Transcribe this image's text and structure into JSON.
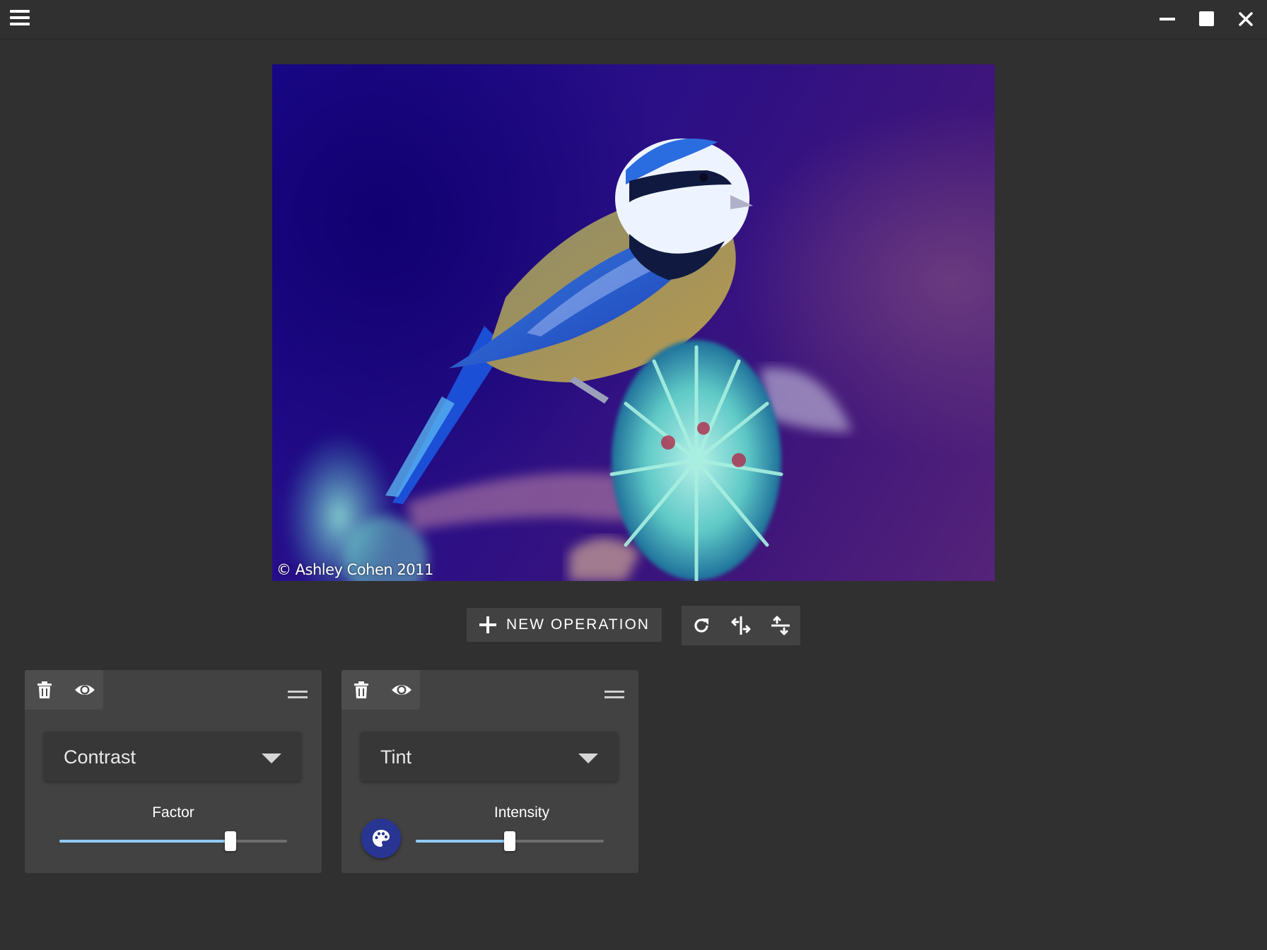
{
  "window": {
    "menu_icon": "hamburger-icon",
    "controls": [
      "minimize-icon",
      "maximize-icon",
      "close-icon"
    ]
  },
  "image": {
    "caption": "© Ashley Cohen 2011"
  },
  "toolbar": {
    "new_operation_label": "NEW OPERATION",
    "actions": [
      "rotate-icon",
      "flip-horizontal-icon",
      "flip-vertical-icon"
    ]
  },
  "operations": [
    {
      "type": "Contrast",
      "param_label": "Factor",
      "slider_fraction": 0.75,
      "has_color_picker": false
    },
    {
      "type": "Tint",
      "param_label": "Intensity",
      "slider_fraction": 0.5,
      "has_color_picker": true,
      "tint_color": "#283593"
    }
  ],
  "colors": {
    "background": "#303030",
    "card": "#424242",
    "slider_fill": "#90caf9",
    "accent": "#283593"
  }
}
